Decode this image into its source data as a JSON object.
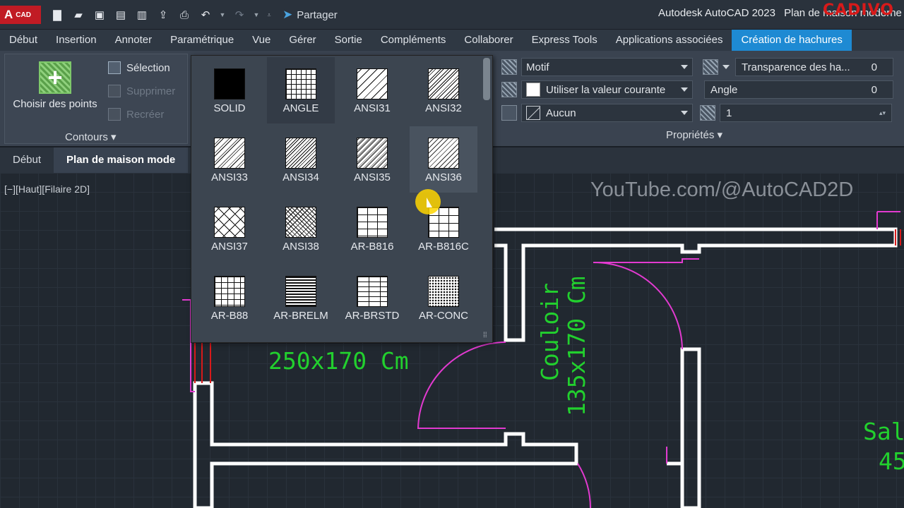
{
  "titlebar": {
    "logo_letter": "A",
    "logo_text": "CAD",
    "share_label": "Partager",
    "app_title": "Autodesk AutoCAD 2023",
    "doc_title": "Plan de maison moderne",
    "brand": "CADIVO"
  },
  "ribbon_tabs": [
    "Début",
    "Insertion",
    "Annoter",
    "Paramétrique",
    "Vue",
    "Gérer",
    "Sortie",
    "Compléments",
    "Collaborer",
    "Express Tools",
    "Applications associées",
    "Création de hachures"
  ],
  "contours": {
    "pick_points_label": "Choisir des points",
    "selection_label": "Sélection",
    "remove_label": "Supprimer",
    "recreate_label": "Recréer",
    "panel_title": "Contours"
  },
  "properties": {
    "type_value": "Motif",
    "color_value": "Utiliser la valeur courante",
    "background_value": "Aucun",
    "transparency_label": "Transparence des ha...",
    "transparency_value": "0",
    "angle_label": "Angle",
    "angle_value": "0",
    "scale_value": "1",
    "panel_title": "Propriétés"
  },
  "doc_tabs": [
    "Début",
    "Plan de maison mode"
  ],
  "viewport_label": "[−][Haut][Filaire 2D]",
  "watermark": "YouTube.com/@AutoCAD2D",
  "drawing_texts": {
    "room1_dims": "250x170  Cm",
    "corridor_name": "Couloir",
    "corridor_dims": "135x170  Cm",
    "living_name": "Sal",
    "living_dims": "45"
  },
  "patterns": [
    "SOLID",
    "ANGLE",
    "ANSI31",
    "ANSI32",
    "ANSI33",
    "ANSI34",
    "ANSI35",
    "ANSI36",
    "ANSI37",
    "ANSI38",
    "AR-B816",
    "AR-B816C",
    "AR-B88",
    "AR-BRELM",
    "AR-BRSTD",
    "AR-CONC"
  ],
  "selected_pattern": "ANGLE",
  "hovered_pattern": "ANSI36"
}
